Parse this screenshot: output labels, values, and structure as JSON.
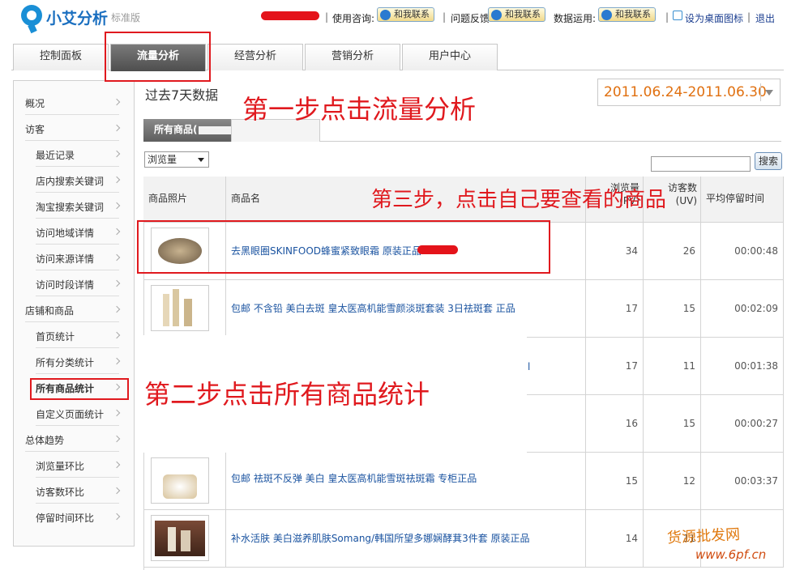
{
  "header": {
    "brand": "小艾分析",
    "edition": "标准版",
    "consult_label": "使用咨询:",
    "feedback_label": "问题反馈:",
    "data_label": "数据运用:",
    "contact_btn": "和我联系",
    "desktop_icon": "设为桌面图标",
    "logout": "退出"
  },
  "tabs": [
    "控制面板",
    "流量分析",
    "经营分析",
    "营销分析",
    "用户中心"
  ],
  "active_tab": "流量分析",
  "sidebar": {
    "items": [
      {
        "label": "概况",
        "level": "top"
      },
      {
        "label": "访客",
        "level": "top"
      },
      {
        "label": "最近记录",
        "level": "sub"
      },
      {
        "label": "店内搜索关键词",
        "level": "sub"
      },
      {
        "label": "淘宝搜索关键词",
        "level": "sub"
      },
      {
        "label": "访问地域详情",
        "level": "sub"
      },
      {
        "label": "访问来源详情",
        "level": "sub"
      },
      {
        "label": "访问时段详情",
        "level": "sub"
      },
      {
        "label": "店铺和商品",
        "level": "top"
      },
      {
        "label": "首页统计",
        "level": "sub"
      },
      {
        "label": "所有分类统计",
        "level": "sub"
      },
      {
        "label": "所有商品统计",
        "level": "sub",
        "selected": true
      },
      {
        "label": "自定义页面统计",
        "level": "sub"
      },
      {
        "label": "总体趋势",
        "level": "top"
      },
      {
        "label": "浏览量环比",
        "level": "sub"
      },
      {
        "label": "访客数环比",
        "level": "sub"
      },
      {
        "label": "停留时间环比",
        "level": "sub"
      }
    ]
  },
  "main": {
    "title": "过去7天数据",
    "date_range": "2011.06.24-2011.06.30",
    "subtab": "所有商品(",
    "metric_select": "浏览量",
    "search_button": "搜索"
  },
  "table": {
    "columns": [
      "商品照片",
      "商品名",
      "浏览量(PV)",
      "访客数(UV)",
      "平均停留时间"
    ],
    "rows": [
      {
        "name": "去黑眼圈SKINFOOD蜂蜜紧致眼霜 原装正品",
        "pv": "34",
        "uv": "26",
        "time": "00:00:48"
      },
      {
        "name": "包邮 不含铅 美白去斑 皇太医高机能雪颜淡斑套装 3日祛斑套 正品",
        "pv": "17",
        "uv": "15",
        "time": "00:02:09"
      },
      {
        "name": "",
        "pv": "17",
        "uv": "11",
        "time": "00:01:38"
      },
      {
        "name": "",
        "pv": "16",
        "uv": "15",
        "time": "00:00:27"
      },
      {
        "name": "包邮 祛斑不反弹 美白 皇太医高机能雪斑祛斑霜 专柜正品",
        "pv": "15",
        "uv": "12",
        "time": "00:03:37"
      },
      {
        "name": "补水活肤 美白滋养肌肤Somang/韩国所望多娜娴酵萁3件套 原装正品",
        "pv": "14",
        "uv": "11",
        "time": ""
      }
    ]
  },
  "annotations": {
    "step1": "第一步点击流量分析",
    "step2": "第二步点击所有商品统计",
    "step3": "第三步，点击自己要查看的商品"
  },
  "watermark": {
    "line1": "货源批发网",
    "line2": "www.6pf.cn"
  }
}
